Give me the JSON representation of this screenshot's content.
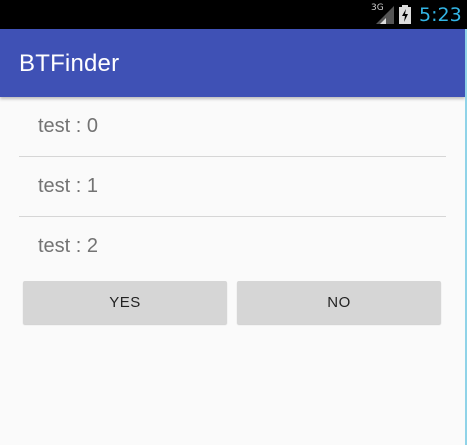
{
  "status_bar": {
    "network": "3G",
    "time": "5:23",
    "signal_icon": "signal-icon",
    "battery_icon": "battery-charging-icon"
  },
  "app_bar": {
    "title": "BTFinder",
    "color": "#3f51b5"
  },
  "list": {
    "items": [
      {
        "label": "test : 0"
      },
      {
        "label": "test : 1"
      },
      {
        "label": "test : 2"
      }
    ]
  },
  "buttons": {
    "yes_label": "YES",
    "no_label": "NO"
  }
}
